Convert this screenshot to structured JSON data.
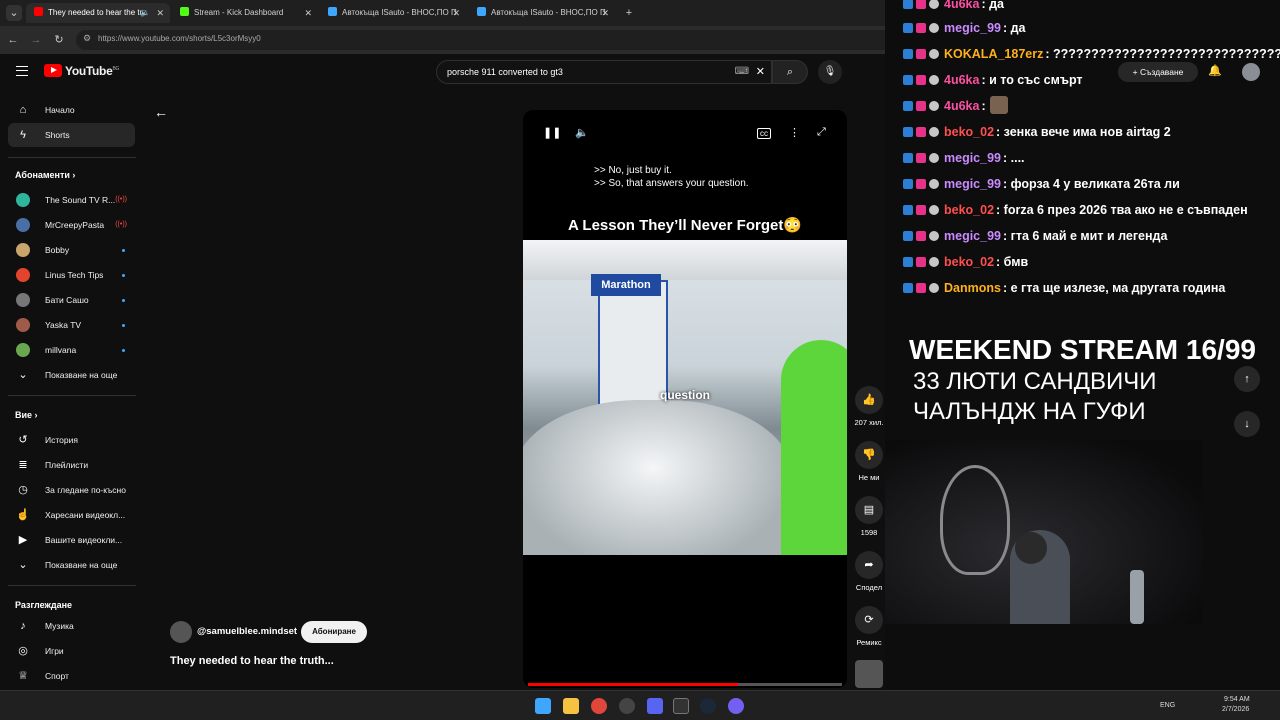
{
  "browser": {
    "tabs": [
      {
        "label": "They needed to hear the tru",
        "color": "#ff0000"
      },
      {
        "label": "Stream - Kick Dashboard",
        "color": "#53fc18"
      },
      {
        "label": "Автокъща ISauto - ВНОС,ПО П",
        "color": "#3ea6ff"
      },
      {
        "label": "Автокъща ISauto - ВНОС,ПО П",
        "color": "#3ea6ff"
      }
    ],
    "url": "https://www.youtube.com/shorts/L5c3orMsyy0"
  },
  "youtube": {
    "logo_text": "YouTube",
    "logo_region": "BG",
    "search_query": "porsche 911 converted to gt3",
    "create_label": "Създаване",
    "sidebar": {
      "home": "Начало",
      "shorts": "Shorts",
      "subscriptions_heading": "Абонаменти",
      "subscriptions": [
        {
          "name": "The Sound TV R...",
          "indicator": "live",
          "color": "#2fb59b"
        },
        {
          "name": "MrCreepyPasta",
          "indicator": "live",
          "color": "#4a6fa5"
        },
        {
          "name": "Bobby",
          "indicator": "dot",
          "color": "#c9a56b"
        },
        {
          "name": "Linus Tech Tips",
          "indicator": "dot",
          "color": "#e2452b"
        },
        {
          "name": "Бати Сашо",
          "indicator": "dot",
          "color": "#777777"
        },
        {
          "name": "Yaska TV",
          "indicator": "dot",
          "color": "#a05a4a"
        },
        {
          "name": "millvana",
          "indicator": "dot",
          "color": "#6aa84f"
        }
      ],
      "show_more": "Показване на още",
      "you_heading": "Вие",
      "you_items": [
        {
          "label": "История",
          "icon": "history-icon",
          "glyph": "↺"
        },
        {
          "label": "Плейлисти",
          "icon": "playlist-icon",
          "glyph": "≣"
        },
        {
          "label": "За гледане по-късно",
          "icon": "clock-icon",
          "glyph": "◷"
        },
        {
          "label": "Харесани видеокл...",
          "icon": "thumbs-up-icon",
          "glyph": "👍"
        },
        {
          "label": "Вашите видеокли...",
          "icon": "your-videos-icon",
          "glyph": "▶"
        }
      ],
      "show_more_2": "Показване на още",
      "explore_heading": "Разглеждане",
      "explore_items": [
        {
          "label": "Музика",
          "icon": "music-icon",
          "glyph": "♪"
        },
        {
          "label": "Игри",
          "icon": "gamepad-icon",
          "glyph": "🎮"
        },
        {
          "label": "Спорт",
          "icon": "trophy-icon",
          "glyph": "🏆"
        }
      ]
    },
    "short": {
      "quote_1": ">> No, just buy it.",
      "quote_2": ">> So, that answers your question.",
      "headline": "A Lesson They’ll Never Forget😳",
      "sign_text": "Marathon",
      "caption": "question",
      "progress": 0.67,
      "likes": "207 хил.",
      "dislike_label": "Не ми",
      "comments": "1598",
      "share_label": "Сподел",
      "remix_label": "Ремикс",
      "channel": "@samuelblee.mindset",
      "subscribe_label": "Абониране",
      "title": "They needed to hear the truth..."
    }
  },
  "overlay": {
    "chat": [
      {
        "user": "4u6ka",
        "color": "#ff4fa3",
        "msg": ": да"
      },
      {
        "user": "megic_99",
        "color": "#c98bff",
        "msg": ": да"
      },
      {
        "user": "KOKALA_187erz",
        "color": "#ffb11b",
        "msg": ": ??????????????????????????????"
      },
      {
        "user": "4u6ka",
        "color": "#ff4fa3",
        "msg": ": и то със смърт"
      },
      {
        "user": "4u6ka",
        "color": "#ff4fa3",
        "msg": ":",
        "emote": true
      },
      {
        "user": "beko_02",
        "color": "#ff4f4f",
        "msg": ": зенка вече има нов airtag 2"
      },
      {
        "user": "megic_99",
        "color": "#c98bff",
        "msg": ": ...."
      },
      {
        "user": "megic_99",
        "color": "#c98bff",
        "msg": ": форза 4 у великата 26та ли"
      },
      {
        "user": "beko_02",
        "color": "#ff4f4f",
        "msg": ": forza 6 през 2026 тва ако не е съвпаден"
      },
      {
        "user": "megic_99",
        "color": "#c98bff",
        "msg": ": гта 6 май е мит и легенда"
      },
      {
        "user": "beko_02",
        "color": "#ff4f4f",
        "msg": ": бмв"
      },
      {
        "user": "Danmons",
        "color": "#ffb11b",
        "msg": ": е гта ще излезе, ма другата година"
      }
    ],
    "stream_title": "WEEKEND STREAM 16/99",
    "subtitle_1": "33 ЛЮТИ САНДВИЧИ",
    "subtitle_2": "ЧАЛЪНДЖ НА ГУФИ"
  },
  "taskbar": {
    "lang": "ENG",
    "time": "9:54 AM",
    "date": "2/7/2026"
  }
}
